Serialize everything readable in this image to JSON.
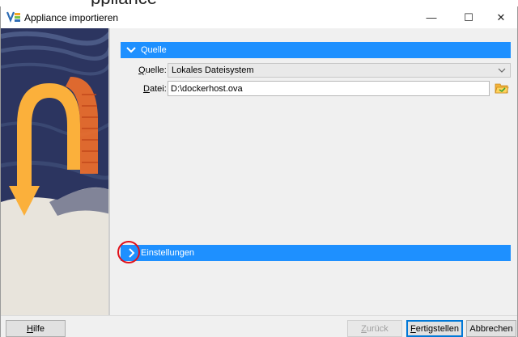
{
  "background_text": "ppliance",
  "window": {
    "title": "Appliance importieren",
    "controls": {
      "minimize": "—",
      "maximize": "☐",
      "close": "✕"
    }
  },
  "sections": {
    "quelle": {
      "header": "Quelle",
      "expanded": true,
      "source_label_accel": "Q",
      "source_label_rest": "uelle:",
      "source_value": "Lokales Dateisystem",
      "file_label_accel": "D",
      "file_label_rest": "atei:",
      "file_value": "D:\\dockerhost.ova"
    },
    "einstellungen": {
      "header": "Einstellungen",
      "expanded": false
    }
  },
  "buttons": {
    "help_accel": "H",
    "help_rest": "ilfe",
    "back_accel": "Z",
    "back_rest": "urück",
    "finish_accel": "F",
    "finish_rest": "ertigstellen",
    "cancel": "Abbrechen"
  },
  "colors": {
    "section_header": "#1e90ff",
    "annotation": "#e0101a",
    "banner_arrow": "#fbb03b",
    "banner_sky": "#2c3560"
  }
}
